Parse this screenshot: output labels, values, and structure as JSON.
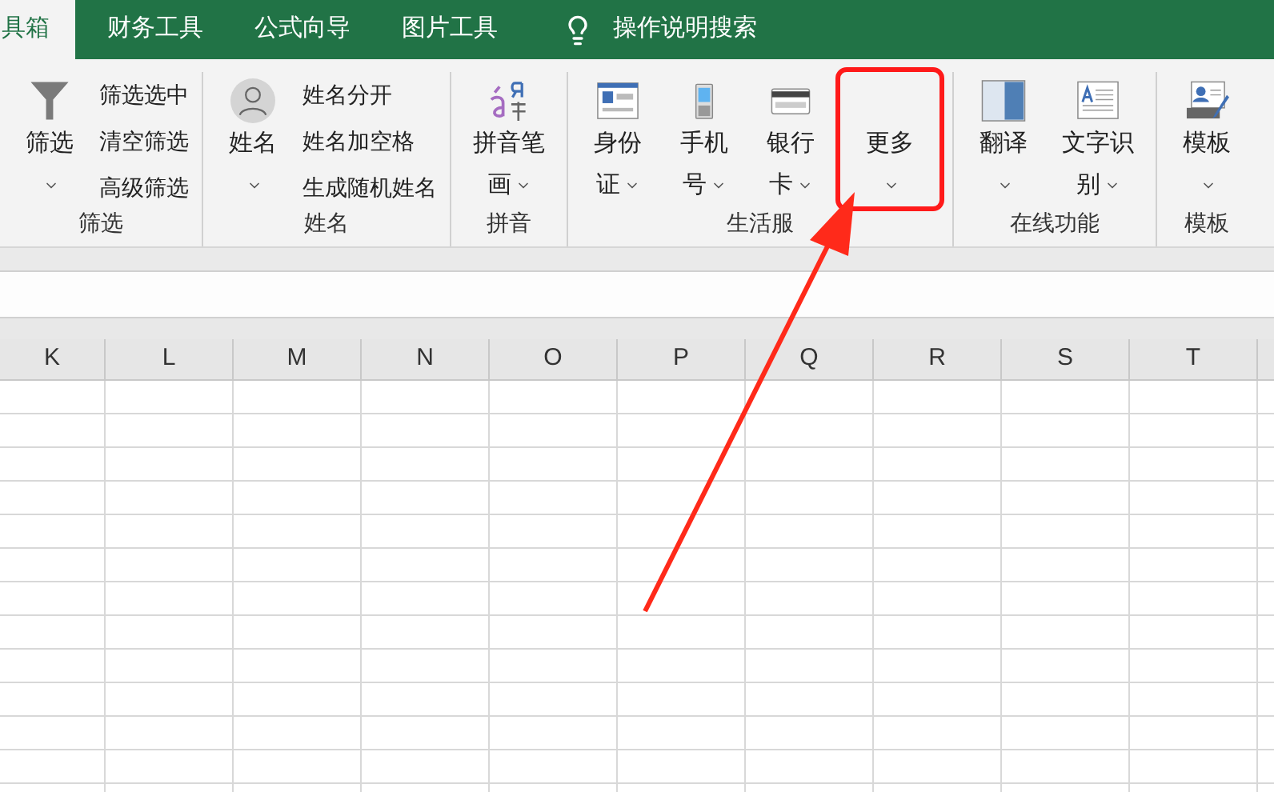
{
  "tabs": [
    {
      "label": "具箱",
      "selected": true
    },
    {
      "label": "财务工具",
      "selected": false
    },
    {
      "label": "公式向导",
      "selected": false
    },
    {
      "label": "图片工具",
      "selected": false
    }
  ],
  "search": {
    "label": "操作说明搜索"
  },
  "groups": [
    {
      "label": "筛选",
      "large": [
        {
          "label": "筛选",
          "highlighted": false
        }
      ],
      "small": [
        "筛选选中",
        "清空筛选",
        "高级筛选"
      ]
    },
    {
      "label": "姓名",
      "large": [
        {
          "label": "姓名",
          "highlighted": false
        }
      ],
      "small": [
        "姓名分开",
        "姓名加空格",
        "生成随机姓名"
      ]
    },
    {
      "label": "拼音",
      "large": [
        {
          "label": "拼音笔画",
          "highlighted": false
        }
      ]
    },
    {
      "label": "生活服",
      "large": [
        {
          "label": "身份证",
          "highlighted": false
        },
        {
          "label": "手机号",
          "highlighted": false
        },
        {
          "label": "银行卡",
          "highlighted": false
        },
        {
          "label": "更多",
          "highlighted": true
        }
      ]
    },
    {
      "label": "在线功能",
      "large": [
        {
          "label": "翻译",
          "highlighted": false
        },
        {
          "label": "文字识别",
          "highlighted": false
        }
      ]
    },
    {
      "label": "模板",
      "large": [
        {
          "label": "模板",
          "highlighted": false
        }
      ]
    }
  ],
  "columns": [
    "K",
    "L",
    "M",
    "N",
    "O",
    "P",
    "Q",
    "R",
    "S",
    "T"
  ]
}
